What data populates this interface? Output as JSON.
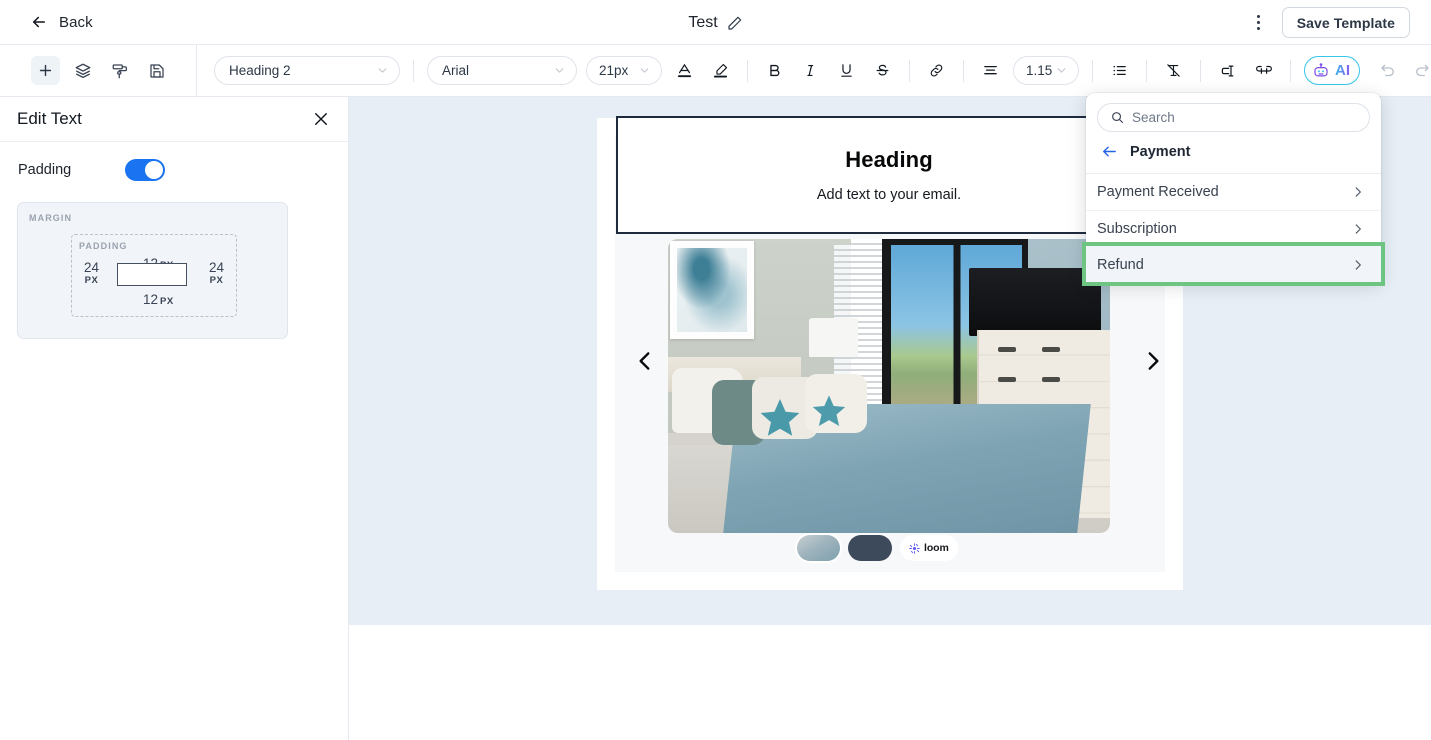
{
  "topbar": {
    "back_label": "Back",
    "doc_title": "Test",
    "edit_title_icon": "pencil-icon",
    "more_icon": "kebab-menu-icon",
    "save_label": "Save Template"
  },
  "left_toolbar": {
    "buttons": [
      {
        "name": "add-block-button",
        "icon": "plus-icon",
        "active": true
      },
      {
        "name": "layers-button",
        "icon": "layers-icon",
        "active": false
      },
      {
        "name": "styles-button",
        "icon": "paint-roller-icon",
        "active": false
      },
      {
        "name": "save-button",
        "icon": "floppy-disk-icon",
        "active": false
      }
    ]
  },
  "format_toolbar": {
    "block_style": "Heading 2",
    "font_family": "Arial",
    "font_size": "21px",
    "line_height": "1.15",
    "icons": [
      {
        "name": "text-color-icon",
        "glyph": "A"
      },
      {
        "name": "highlight-color-icon",
        "glyph": "pen"
      },
      {
        "name": "bold-icon",
        "glyph": "B"
      },
      {
        "name": "italic-icon",
        "glyph": "I"
      },
      {
        "name": "underline-icon",
        "glyph": "U"
      },
      {
        "name": "strikethrough-icon",
        "glyph": "S"
      },
      {
        "name": "link-icon",
        "glyph": "link"
      },
      {
        "name": "align-icon",
        "glyph": "align"
      },
      {
        "name": "bullet-list-icon",
        "glyph": "list"
      },
      {
        "name": "clear-formatting-icon",
        "glyph": "clear"
      },
      {
        "name": "merge-tag-icon",
        "glyph": "tag"
      },
      {
        "name": "unlink-icon",
        "glyph": "unlink"
      }
    ],
    "ai_label": "AI",
    "undo_icon": "undo-icon",
    "redo_icon": "redo-icon"
  },
  "left_panel": {
    "title": "Edit Text",
    "close_icon": "close-icon",
    "padding_label": "Padding",
    "padding_enabled": true,
    "box_model": {
      "margin_label": "MARGIN",
      "padding_label": "PADDING",
      "top": "12",
      "top_unit": "PX",
      "bottom": "12",
      "bottom_unit": "PX",
      "left": "24",
      "left_unit": "PX",
      "right": "24",
      "right_unit": "PX"
    }
  },
  "canvas": {
    "heading_block": {
      "title": "Heading",
      "subtitle": "Add text to your email."
    },
    "carousel": {
      "prev_icon": "chevron-left-icon",
      "next_icon": "chevron-right-icon"
    },
    "loom": {
      "brand": "loom",
      "logo_icon": "loom-logo-icon"
    }
  },
  "dropdown": {
    "search_placeholder": "Search",
    "search_value": "",
    "search_icon": "search-icon",
    "breadcrumb": {
      "back_icon": "arrow-left-icon",
      "label": "Payment"
    },
    "items": [
      {
        "label": "Payment Received",
        "chevron": "chevron-right-icon",
        "highlighted": false
      },
      {
        "label": "Subscription",
        "chevron": "chevron-right-icon",
        "highlighted": false
      },
      {
        "label": "Refund",
        "chevron": "chevron-right-icon",
        "highlighted": true
      }
    ],
    "highlight_color": "#6ec481"
  },
  "colors": {
    "accent_blue": "#1a73f0",
    "canvas_bg": "#e7eef5",
    "selection_border": "#1e2b3d",
    "ai_gradient_start": "#3ab7ea",
    "ai_gradient_end": "#8b5cf6"
  }
}
